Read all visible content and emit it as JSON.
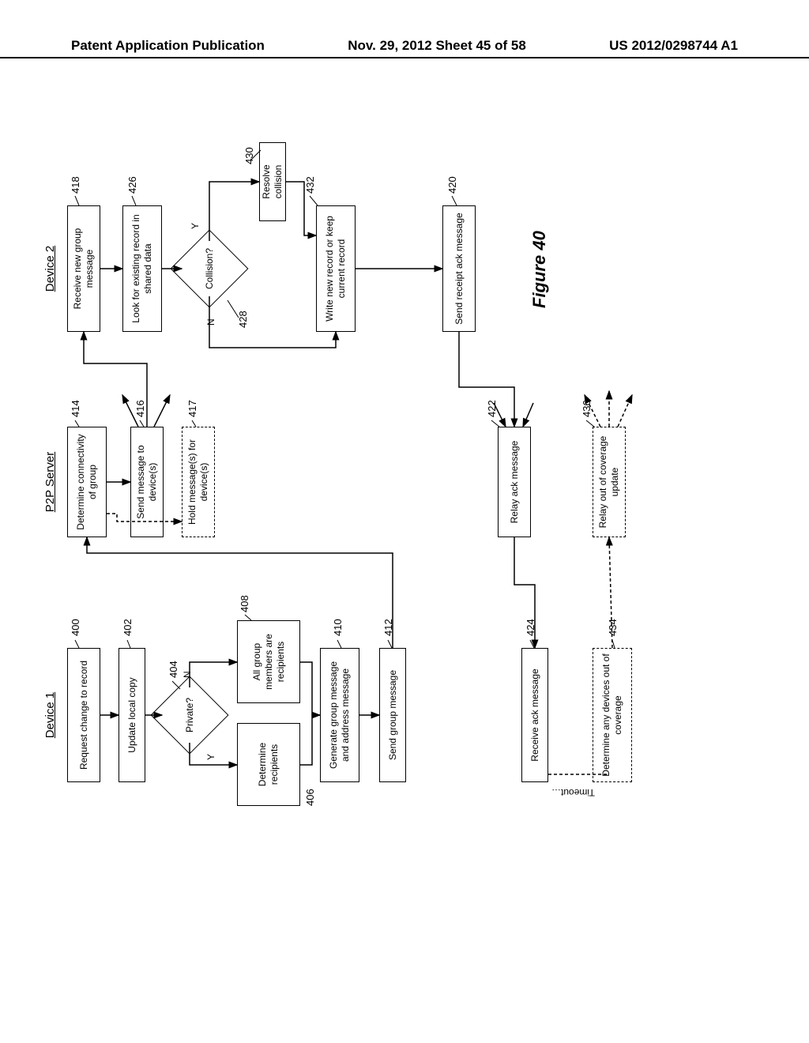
{
  "header": {
    "left": "Patent Application Publication",
    "middle": "Nov. 29, 2012  Sheet 45 of 58",
    "right": "US 2012/0298744 A1"
  },
  "cols": {
    "dev1": "Device 1",
    "p2p": "P2P Server",
    "dev2": "Device 2"
  },
  "boxes": {
    "b400": "Request change to record",
    "b402": "Update local copy",
    "d404": "Private?",
    "b406": "Determine recipients",
    "b408": "All group members are recipients",
    "b410": "Generate group message and address message",
    "b412": "Send group message",
    "b424": "Receive ack message",
    "b434": "Determine any devices out of coverage",
    "b414": "Determine connectivity of group",
    "b416": "Send message to device(s)",
    "b417": "Hold message(s) for device(s)",
    "b422": "Relay ack message",
    "b436": "Relay out of coverage update",
    "b418": "Receive new group message",
    "b426": "Look for existing record in shared data",
    "d428": "Collision?",
    "b430": "Resolve collision",
    "b432": "Write new record or keep current record",
    "b420": "Send receipt ack message"
  },
  "yn": {
    "y": "Y",
    "n": "N"
  },
  "timeout": "Timeout…",
  "refs": {
    "r400": "400",
    "r402": "402",
    "r404": "404",
    "r406": "406",
    "r408": "408",
    "r410": "410",
    "r412": "412",
    "r414": "414",
    "r416": "416",
    "r417": "417",
    "r418": "418",
    "r420": "420",
    "r422": "422",
    "r424": "424",
    "r426": "426",
    "r428": "428",
    "r430": "430",
    "r432": "432",
    "r434": "434",
    "r436": "436"
  },
  "figure_label": "Figure 40"
}
